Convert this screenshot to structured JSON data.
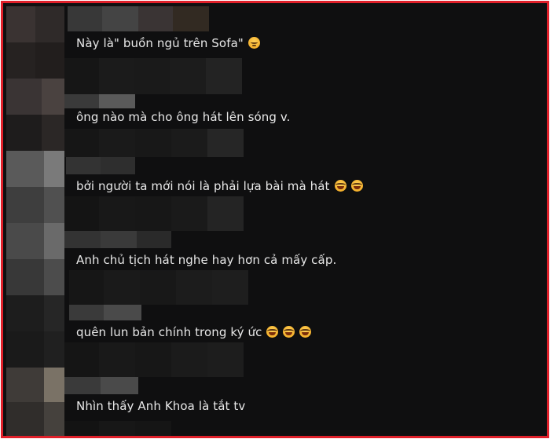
{
  "comments": [
    {
      "text": "Này là\" buồn ngủ trên Sofa\"",
      "emojis": [
        "sleepy-face"
      ]
    },
    {
      "text": "ông nào mà cho ông hát lên sóng v.",
      "emojis": []
    },
    {
      "text": "bởi người ta mới nói là phải lựa bài mà hát",
      "emojis": [
        "laughing-face",
        "laughing-face"
      ]
    },
    {
      "text": "Anh chủ tịch hát nghe hay hơn cả mấy cấp.",
      "emojis": []
    },
    {
      "text": "quên lun bản chính trong ký ức",
      "emojis": [
        "laughing-face",
        "laughing-face",
        "laughing-face"
      ]
    },
    {
      "text": "Nhìn thấy Anh Khoa là tắt tv",
      "emojis": []
    }
  ],
  "colors": {
    "border": "#e0202a",
    "background": "#0f0f10",
    "text": "#e8e8e8"
  }
}
